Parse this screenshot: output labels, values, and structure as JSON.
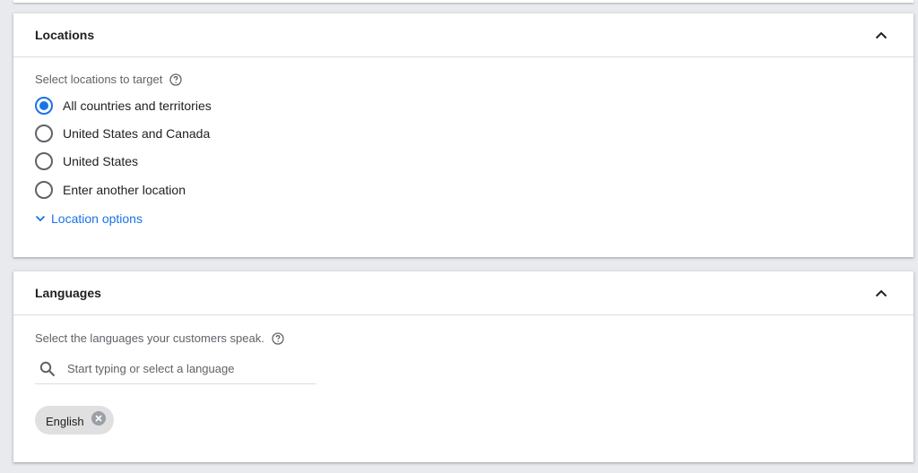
{
  "locations": {
    "title": "Locations",
    "section_label": "Select locations to target",
    "options": [
      {
        "label": "All countries and territories",
        "selected": true
      },
      {
        "label": "United States and Canada",
        "selected": false
      },
      {
        "label": "United States",
        "selected": false
      },
      {
        "label": "Enter another location",
        "selected": false
      }
    ],
    "more_options_label": "Location options"
  },
  "languages": {
    "title": "Languages",
    "section_label": "Select the languages your customers speak.",
    "search": {
      "placeholder": "Start typing or select a language",
      "value": ""
    },
    "selected_chips": [
      {
        "label": "English"
      }
    ]
  },
  "icons": {
    "collapse": "chevron-up-icon",
    "help": "help-circle-icon",
    "expand": "chevron-down-icon",
    "search": "search-icon",
    "remove": "close-circle-icon"
  },
  "colors": {
    "accent": "#1a73e8",
    "page_background": "#e8eaed",
    "card_background": "#ffffff",
    "chip_background": "#e0e0e0"
  }
}
